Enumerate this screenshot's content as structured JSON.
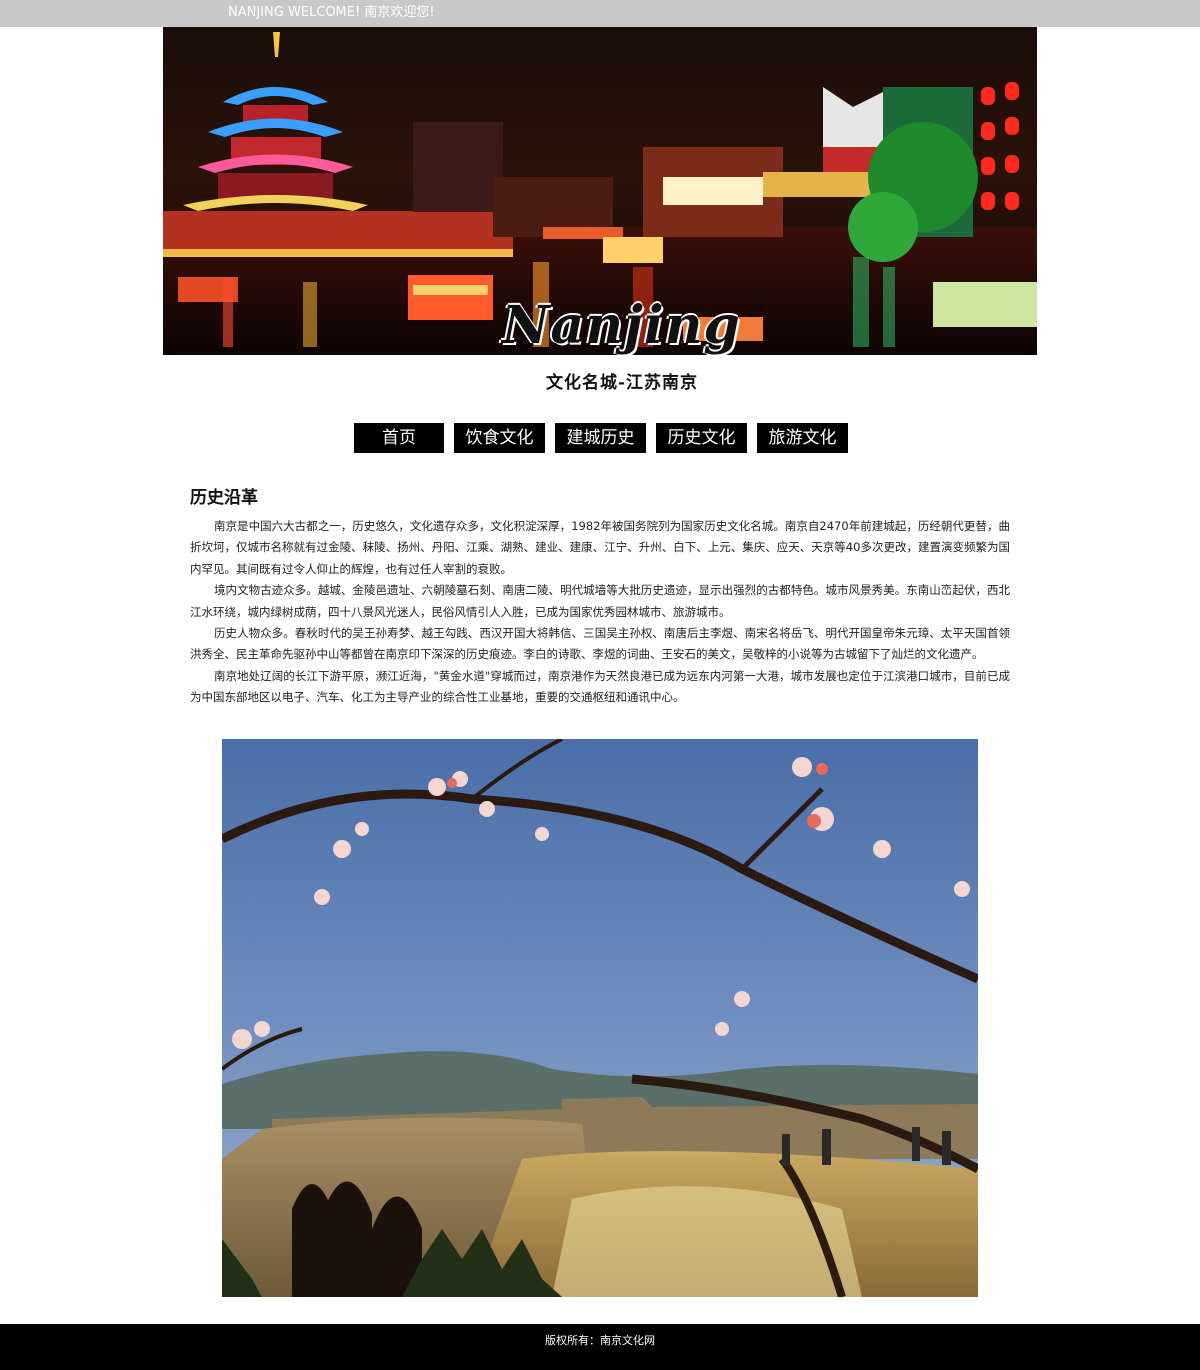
{
  "topbar": {
    "welcome": "NANJING WELCOME! 南京欢迎您!"
  },
  "header": {
    "banner_icon": "nanjing-night-riverside-photo",
    "logo_text": "Nanjing",
    "slogan": "文化名城-江苏南京"
  },
  "nav": {
    "items": [
      {
        "label": "首页"
      },
      {
        "label": "饮食文化"
      },
      {
        "label": "建城历史"
      },
      {
        "label": "历史文化"
      },
      {
        "label": "旅游文化"
      }
    ]
  },
  "article": {
    "title": "历史沿革",
    "paragraphs": [
      "南京是中国六大古都之一，历史悠久，文化遗存众多，文化积淀深厚，1982年被国务院列为国家历史文化名城。南京自2470年前建城起，历经朝代更替，曲折坎坷，仅城市名称就有过金陵、秣陵、扬州、丹阳、江乘、湖熟、建业、建康、江宁、升州、白下、上元、集庆、应天、天京等40多次更改，建置演变频繁为国内罕见。其间既有过令人仰止的辉煌，也有过任人宰割的衰败。",
      "境内文物古迹众多。越城、金陵邑遗址、六朝陵墓石刻、南唐二陵、明代城墙等大批历史遗迹，显示出强烈的古都特色。城市风景秀美。东南山峦起伏，西北江水环绕，城内绿树成荫，四十八景风光迷人，民俗风情引人入胜，已成为国家优秀园林城市、旅游城市。",
      "历史人物众多。春秋时代的吴王孙寿梦、越王勾践、西汉开国大将韩信、三国吴主孙权、南唐后主李煜、南宋名将岳飞、明代开国皇帝朱元璋、太平天国首领洪秀全、民主革命先驱孙中山等都曾在南京印下深深的历史痕迹。李白的诗歌、李煜的词曲、王安石的美文，吴敬梓的小说等为古城留下了灿烂的文化遗产。",
      "南京地处辽阔的长江下游平原，濒江近海，\"黄金水道\"穿城而过，南京港作为天然良港已成为远东内河第一大港，城市发展也定位于江滨港口城市，目前已成为中国东部地区以电子、汽车、化工为主导产业的综合性工业基地，重要的交通枢纽和通讯中心。"
    ],
    "photo_icon": "city-wall-gate-peach-blossom-photo"
  },
  "footer": {
    "copyright": "版权所有：南京文化网"
  },
  "colors": {
    "topbar_bg": "#c8c8c8",
    "nav_bg": "#000000",
    "footer_bg": "#000000"
  }
}
